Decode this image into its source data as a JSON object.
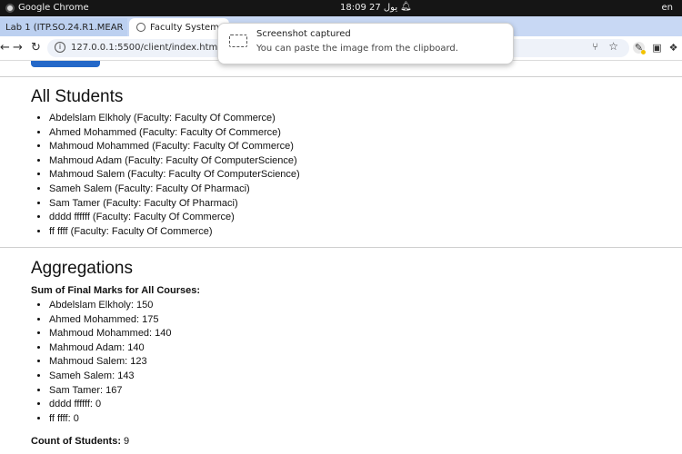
{
  "os": {
    "app_name": "Google Chrome",
    "clock": "18:09  27 يول",
    "language": "en"
  },
  "browser": {
    "tabs": [
      {
        "label": "Lab 1 (ITP.SO.24.R1.MEAR"
      },
      {
        "label": "Faculty System V"
      }
    ],
    "url": "127.0.0.1:5500/client/index.html"
  },
  "toast": {
    "title": "Screenshot captured",
    "message": "You can paste the image from the clipboard."
  },
  "page": {
    "students_heading": "All Students",
    "students": [
      "Abdelslam Elkholy (Faculty: Faculty Of Commerce)",
      "Ahmed Mohammed (Faculty: Faculty Of Commerce)",
      "Mahmoud Mohammed (Faculty: Faculty Of Commerce)",
      "Mahmoud Adam (Faculty: Faculty Of ComputerScience)",
      "Mahmoud Salem (Faculty: Faculty Of ComputerScience)",
      "Sameh Salem (Faculty: Faculty Of Pharmaci)",
      "Sam Tamer (Faculty: Faculty Of Pharmaci)",
      "dddd ffffff (Faculty: Faculty Of Commerce)",
      "ff ffff (Faculty: Faculty Of Commerce)"
    ],
    "aggregations_heading": "Aggregations",
    "sum_label": "Sum of Final Marks for All Courses:",
    "marks": [
      "Abdelslam Elkholy: 150",
      "Ahmed Mohammed: 175",
      "Mahmoud Mohammed: 140",
      "Mahmoud Adam: 140",
      "Mahmoud Salem: 123",
      "Sameh Salem: 143",
      "Sam Tamer: 167",
      "dddd ffffff: 0",
      "ff ffff: 0"
    ],
    "count_label": "Count of Students:",
    "count_value": "9"
  }
}
